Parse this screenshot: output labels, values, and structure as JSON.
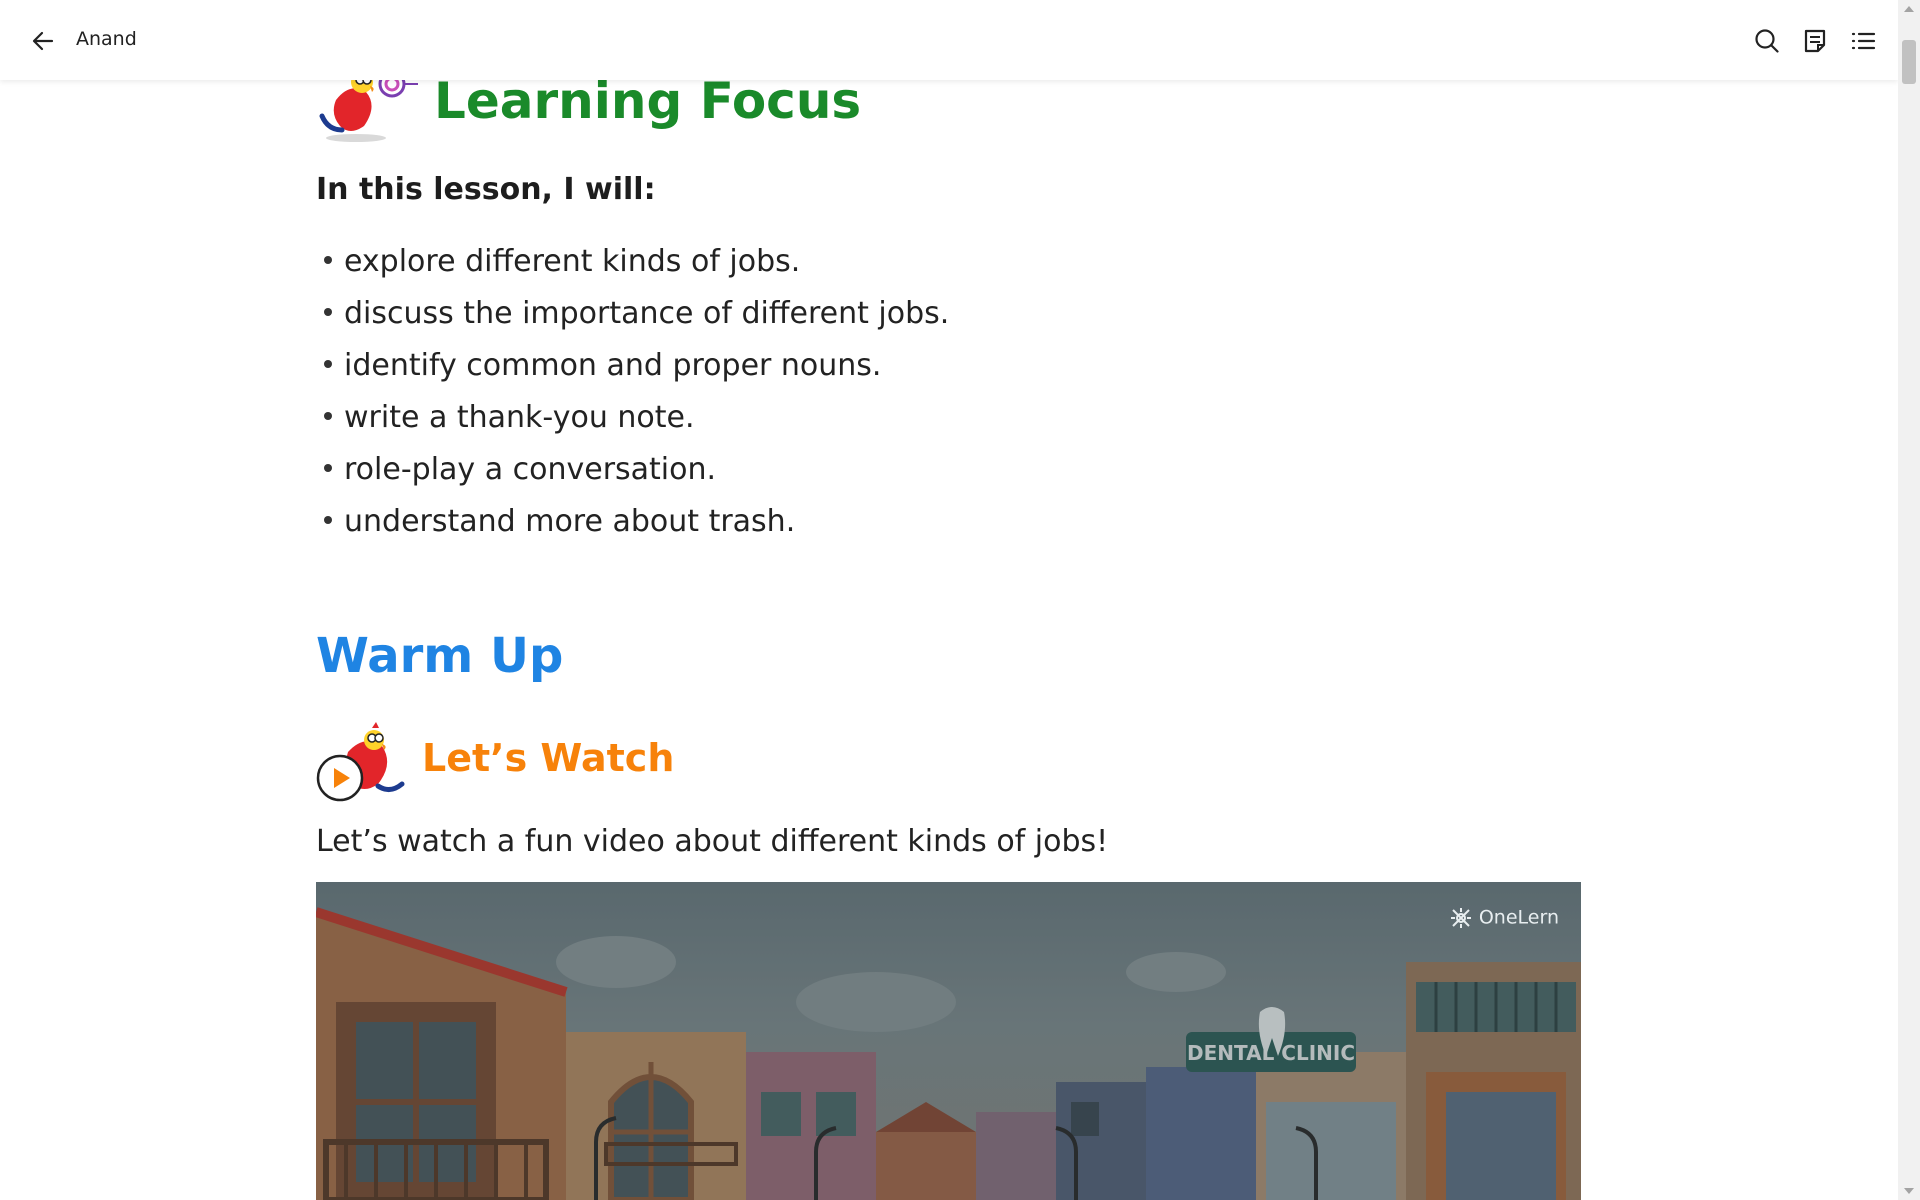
{
  "header": {
    "title": "Anand",
    "icons": [
      "back-arrow-icon",
      "search-icon",
      "notes-icon",
      "contents-list-icon"
    ]
  },
  "learning_focus": {
    "title": "Learning Focus",
    "intro": "In this lesson, I will:",
    "goals": [
      "explore different kinds of jobs.",
      "discuss the importance of different jobs.",
      "identify common and proper nouns.",
      "write a thank-you note.",
      "role-play a conversation.",
      "understand more about trash."
    ]
  },
  "warm_up": {
    "title": "Warm Up",
    "lets_watch": {
      "title": "Let’s Watch",
      "description": "Let’s watch a fun video about different kinds of jobs!"
    },
    "video": {
      "brand": "OneLern",
      "sign_text": "DENTAL CLINIC"
    }
  },
  "colors": {
    "learning_focus": "#1a8a2a",
    "warm_up": "#1f84e3",
    "lets_watch": "#f7820a"
  }
}
